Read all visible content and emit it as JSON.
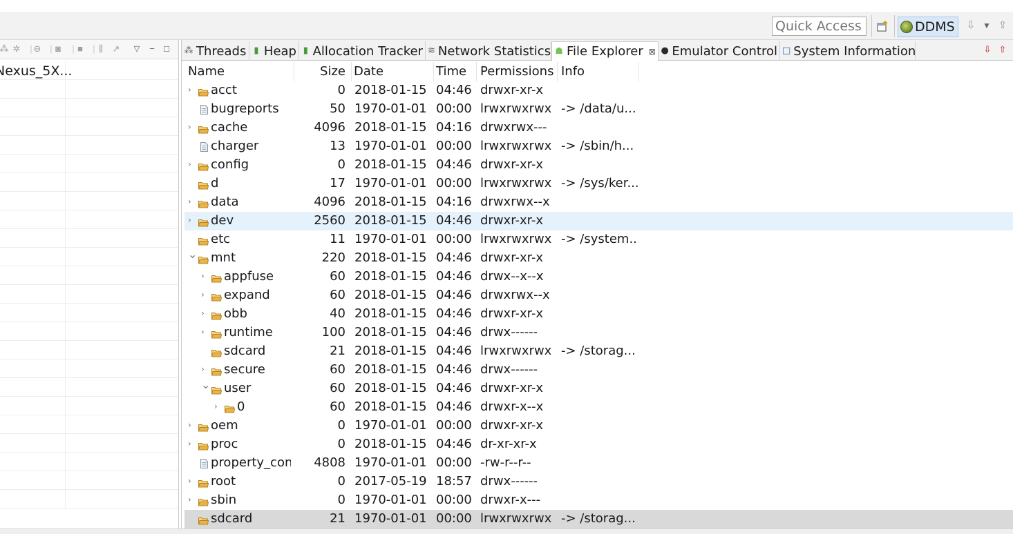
{
  "toolbar": {
    "quick_access_placeholder": "Quick Access",
    "perspective_label": "DDMS",
    "icons": [
      "open-perspective-icon",
      "ddms-perspective-icon",
      "import-icon",
      "dropdown-icon",
      "export-icon"
    ]
  },
  "devices_panel": {
    "rows": [
      {
        "name": "Nexus_5X..."
      }
    ],
    "empty_rows": 23,
    "icons": [
      "debug-process-icon",
      "update-heap-icon",
      "dump-hprof-icon",
      "cause-gc-icon",
      "stop-process-icon",
      "screen-capture-icon",
      "dump-view-hierarchy-icon",
      "capture-systrace-icon",
      "start-method-profiling-icon",
      "view-menu-icon",
      "minimize-icon",
      "maximize-icon"
    ]
  },
  "tabs": [
    {
      "label": "Threads",
      "icon": "threads-icon",
      "active": false
    },
    {
      "label": "Heap",
      "icon": "heap-icon",
      "active": false
    },
    {
      "label": "Allocation Tracker",
      "icon": "allocation-icon",
      "active": false
    },
    {
      "label": "Network Statistics",
      "icon": "network-icon",
      "active": false
    },
    {
      "label": "File Explorer",
      "icon": "android-icon",
      "active": true
    },
    {
      "label": "Emulator Control",
      "icon": "emulator-icon",
      "active": false
    },
    {
      "label": "System Information",
      "icon": "sysinfo-icon",
      "active": false
    }
  ],
  "file_explorer": {
    "columns": [
      "Name",
      "Size",
      "Date",
      "Time",
      "Permissions",
      "Info"
    ],
    "rows": [
      {
        "name": "acct",
        "size": "0",
        "date": "2018-01-15",
        "time": "04:46",
        "perm": "drwxr-xr-x",
        "info": "",
        "type": "folder",
        "expander": "collapsed",
        "depth": 0
      },
      {
        "name": "bugreports",
        "size": "50",
        "date": "1970-01-01",
        "time": "00:00",
        "perm": "lrwxrwxrwx",
        "info": "-> /data/u...",
        "type": "file",
        "expander": "none",
        "depth": 0
      },
      {
        "name": "cache",
        "size": "4096",
        "date": "2018-01-15",
        "time": "04:16",
        "perm": "drwxrwx---",
        "info": "",
        "type": "folder",
        "expander": "collapsed",
        "depth": 0
      },
      {
        "name": "charger",
        "size": "13",
        "date": "1970-01-01",
        "time": "00:00",
        "perm": "lrwxrwxrwx",
        "info": "-> /sbin/h...",
        "type": "file",
        "expander": "none",
        "depth": 0
      },
      {
        "name": "config",
        "size": "0",
        "date": "2018-01-15",
        "time": "04:46",
        "perm": "drwxr-xr-x",
        "info": "",
        "type": "folder",
        "expander": "collapsed",
        "depth": 0
      },
      {
        "name": "d",
        "size": "17",
        "date": "1970-01-01",
        "time": "00:00",
        "perm": "lrwxrwxrwx",
        "info": "-> /sys/ker...",
        "type": "folder",
        "expander": "none",
        "depth": 0
      },
      {
        "name": "data",
        "size": "4096",
        "date": "2018-01-15",
        "time": "04:16",
        "perm": "drwxrwx--x",
        "info": "",
        "type": "folder",
        "expander": "collapsed",
        "depth": 0
      },
      {
        "name": "dev",
        "size": "2560",
        "date": "2018-01-15",
        "time": "04:46",
        "perm": "drwxr-xr-x",
        "info": "",
        "type": "folder",
        "expander": "collapsed",
        "depth": 0,
        "selected": true
      },
      {
        "name": "etc",
        "size": "11",
        "date": "1970-01-01",
        "time": "00:00",
        "perm": "lrwxrwxrwx",
        "info": "-> /system...",
        "type": "folder",
        "expander": "none",
        "depth": 0
      },
      {
        "name": "mnt",
        "size": "220",
        "date": "2018-01-15",
        "time": "04:46",
        "perm": "drwxr-xr-x",
        "info": "",
        "type": "folder",
        "expander": "expanded",
        "depth": 0
      },
      {
        "name": "appfuse",
        "size": "60",
        "date": "2018-01-15",
        "time": "04:46",
        "perm": "drwx--x--x",
        "info": "",
        "type": "folder",
        "expander": "collapsed",
        "depth": 1
      },
      {
        "name": "expand",
        "size": "60",
        "date": "2018-01-15",
        "time": "04:46",
        "perm": "drwxrwx--x",
        "info": "",
        "type": "folder",
        "expander": "collapsed",
        "depth": 1
      },
      {
        "name": "obb",
        "size": "40",
        "date": "2018-01-15",
        "time": "04:46",
        "perm": "drwxr-xr-x",
        "info": "",
        "type": "folder",
        "expander": "collapsed",
        "depth": 1
      },
      {
        "name": "runtime",
        "size": "100",
        "date": "2018-01-15",
        "time": "04:46",
        "perm": "drwx------",
        "info": "",
        "type": "folder",
        "expander": "collapsed",
        "depth": 1
      },
      {
        "name": "sdcard",
        "size": "21",
        "date": "2018-01-15",
        "time": "04:46",
        "perm": "lrwxrwxrwx",
        "info": "-> /storag...",
        "type": "folder",
        "expander": "none",
        "depth": 1
      },
      {
        "name": "secure",
        "size": "60",
        "date": "2018-01-15",
        "time": "04:46",
        "perm": "drwx------",
        "info": "",
        "type": "folder",
        "expander": "collapsed",
        "depth": 1
      },
      {
        "name": "user",
        "size": "60",
        "date": "2018-01-15",
        "time": "04:46",
        "perm": "drwxr-xr-x",
        "info": "",
        "type": "folder",
        "expander": "expanded",
        "depth": 1
      },
      {
        "name": "0",
        "size": "60",
        "date": "2018-01-15",
        "time": "04:46",
        "perm": "drwxr-x--x",
        "info": "",
        "type": "folder",
        "expander": "collapsed",
        "depth": 2
      },
      {
        "name": "oem",
        "size": "0",
        "date": "1970-01-01",
        "time": "00:00",
        "perm": "drwxr-xr-x",
        "info": "",
        "type": "folder",
        "expander": "collapsed",
        "depth": 0
      },
      {
        "name": "proc",
        "size": "0",
        "date": "2018-01-15",
        "time": "04:46",
        "perm": "dr-xr-xr-x",
        "info": "",
        "type": "folder",
        "expander": "collapsed",
        "depth": 0
      },
      {
        "name": "property_cont",
        "size": "4808",
        "date": "1970-01-01",
        "time": "00:00",
        "perm": "-rw-r--r--",
        "info": "",
        "type": "file",
        "expander": "none",
        "depth": 0
      },
      {
        "name": "root",
        "size": "0",
        "date": "2017-05-19",
        "time": "18:57",
        "perm": "drwx------",
        "info": "",
        "type": "folder",
        "expander": "collapsed",
        "depth": 0
      },
      {
        "name": "sbin",
        "size": "0",
        "date": "1970-01-01",
        "time": "00:00",
        "perm": "drwxr-x---",
        "info": "",
        "type": "folder",
        "expander": "collapsed",
        "depth": 0
      },
      {
        "name": "sdcard",
        "size": "21",
        "date": "1970-01-01",
        "time": "00:00",
        "perm": "lrwxrwxrwx",
        "info": "-> /storag...",
        "type": "folder",
        "expander": "none",
        "depth": 0,
        "selected_inactive": true
      }
    ]
  },
  "colors": {
    "selection": "#e5f1fb",
    "selection_inactive": "#d9d9d9",
    "folder": "#e8b34a",
    "ddms_highlight": "#d8e8f8",
    "android_green": "#78c257"
  }
}
